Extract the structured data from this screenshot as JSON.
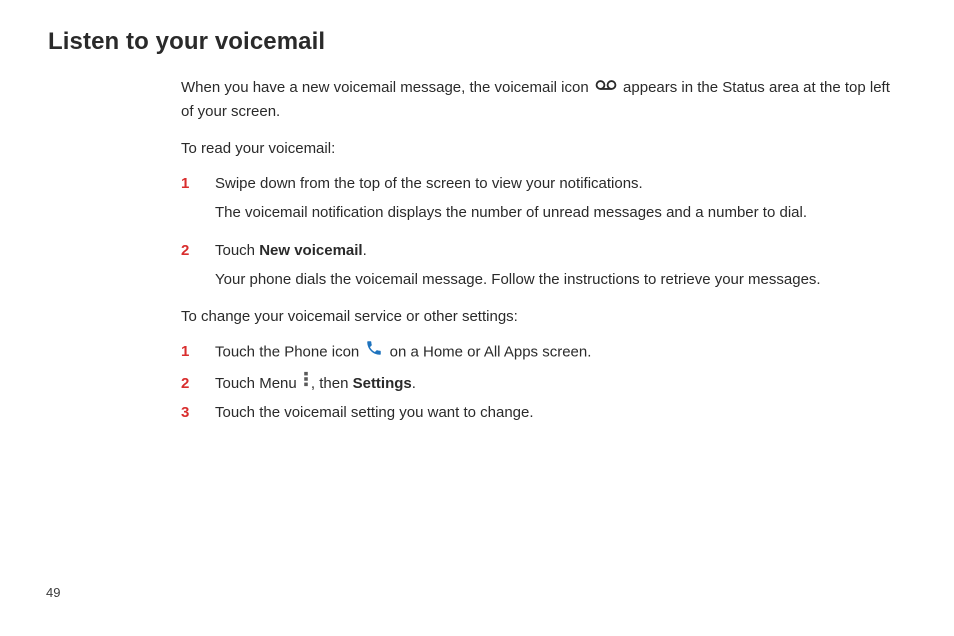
{
  "heading": "Listen to your voicemail",
  "intro1a": "When you have a new voicemail message, the voicemail icon ",
  "intro1b": " appears in the Status area at the top left of your screen.",
  "toRead": "To read your voicemail:",
  "listA": {
    "s1": {
      "num": "1",
      "line1": "Swipe down from the top of the screen to view your notifications.",
      "line2": "The voicemail notification displays the number of unread messages and a number to dial."
    },
    "s2": {
      "num": "2",
      "pre": "Touch ",
      "bold": "New voicemail",
      "post": ".",
      "line2": "Your phone dials the voicemail message. Follow the instructions to retrieve your messages."
    }
  },
  "toChange": "To change your voicemail service or other settings:",
  "listB": {
    "s1": {
      "num": "1",
      "pre": "Touch the Phone icon ",
      "post": " on a Home or All Apps screen."
    },
    "s2": {
      "num": "2",
      "pre": "Touch Menu ",
      "mid": ", then ",
      "bold": "Settings",
      "post": "."
    },
    "s3": {
      "num": "3",
      "text": "Touch the voicemail setting you want to change."
    }
  },
  "pageNumber": "49"
}
